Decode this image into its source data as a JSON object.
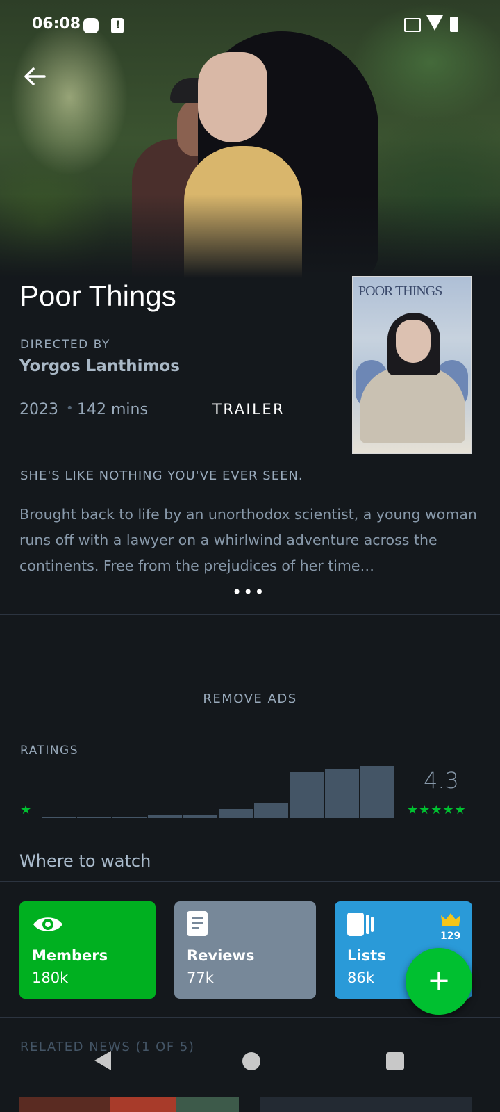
{
  "status_bar": {
    "time": "06:08"
  },
  "film": {
    "title": "Poor Things",
    "directed_by_label": "DIRECTED BY",
    "director": "Yorgos Lanthimos",
    "year": "2023",
    "separator": "•",
    "runtime": "142 mins",
    "trailer_label": "TRAILER",
    "poster_title": "POOR THINGS",
    "tagline": "SHE'S LIKE NOTHING YOU'VE EVER SEEN.",
    "synopsis": "Brought back to life by an unorthodox scientist, a young woman runs off with a lawyer on a whirlwind adventure across the continents. Free from the prejudices of her time…",
    "more_label": "•••"
  },
  "remove_ads_label": "REMOVE ADS",
  "ratings": {
    "label": "RATINGS",
    "average": "4.3",
    "min_star": "★",
    "max_stars": "★★★★★",
    "histogram": [
      0.02,
      0.02,
      0.02,
      0.05,
      0.06,
      0.16,
      0.28,
      0.82,
      0.88,
      0.94
    ]
  },
  "where_to_watch_label": "Where to watch",
  "cards": {
    "members": {
      "label": "Members",
      "count": "180k"
    },
    "reviews": {
      "label": "Reviews",
      "count": "77k"
    },
    "lists": {
      "label": "Lists",
      "count": "86k",
      "badge": "129"
    }
  },
  "fab_label": "+",
  "related_news_label": "RELATED NEWS (1 OF 5)",
  "colors": {
    "background": "#14181c",
    "accent_green": "#00c030",
    "members_card": "#00b020",
    "reviews_card": "#778899",
    "lists_card": "#2a9ad8",
    "crown": "#f5c518"
  }
}
